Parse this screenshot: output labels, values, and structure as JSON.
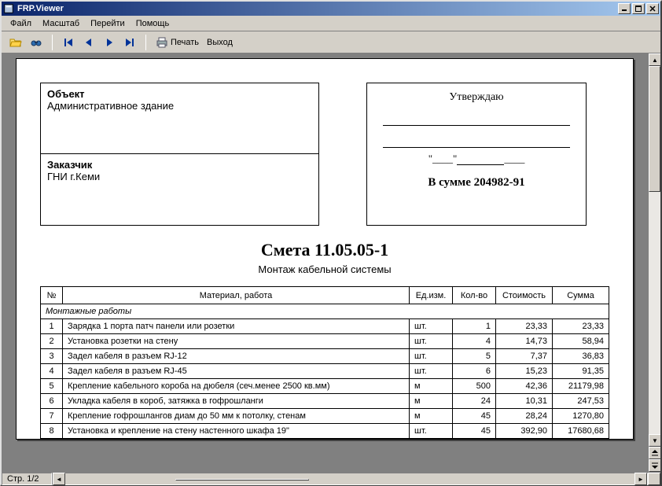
{
  "window": {
    "title": "FRP.Viewer"
  },
  "menu": {
    "file": "Файл",
    "zoom": "Масштаб",
    "goto": "Перейти",
    "help": "Помощь"
  },
  "toolbar": {
    "print": "Печать",
    "exit": "Выход"
  },
  "status": {
    "page": "Стр. 1/2"
  },
  "doc": {
    "object_label": "Объект",
    "object_value": "Административное здание",
    "customer_label": "Заказчик",
    "customer_value": "ГНИ г.Кеми",
    "approve": "Утверждаю",
    "sum_prefix": "В сумме ",
    "sum_value": "204982-91",
    "title": "Смета 11.05.05-1",
    "subtitle": "Монтаж кабельной системы",
    "headers": {
      "n": "№",
      "item": "Материал, работа",
      "unit": "Ед.изм.",
      "qty": "Кол-во",
      "cost": "Стоимость",
      "sum": "Сумма"
    },
    "section": "Монтажные работы",
    "rows": [
      {
        "n": "1",
        "item": "Зарядка 1 порта патч панели или розетки",
        "unit": "шт.",
        "qty": "1",
        "cost": "23,33",
        "sum": "23,33"
      },
      {
        "n": "2",
        "item": "Установка розетки на стену",
        "unit": "шт.",
        "qty": "4",
        "cost": "14,73",
        "sum": "58,94"
      },
      {
        "n": "3",
        "item": "Задел кабеля в разъем RJ-12",
        "unit": "шт.",
        "qty": "5",
        "cost": "7,37",
        "sum": "36,83"
      },
      {
        "n": "4",
        "item": "Задел кабеля в разъем RJ-45",
        "unit": "шт.",
        "qty": "6",
        "cost": "15,23",
        "sum": "91,35"
      },
      {
        "n": "5",
        "item": "Крепление кабельного короба на дюбеля (сеч.менее 2500 кв.мм)",
        "unit": "м",
        "qty": "500",
        "cost": "42,36",
        "sum": "21179,98"
      },
      {
        "n": "6",
        "item": "Укладка кабеля в короб, затяжка в гофрошланги",
        "unit": "м",
        "qty": "24",
        "cost": "10,31",
        "sum": "247,53"
      },
      {
        "n": "7",
        "item": "Крепление гофрошлангов диам до 50 мм к потолку, стенам",
        "unit": "м",
        "qty": "45",
        "cost": "28,24",
        "sum": "1270,80"
      },
      {
        "n": "8",
        "item": "Установка и крепление на стену настенного шкафа 19\"",
        "unit": "шт.",
        "qty": "45",
        "cost": "392,90",
        "sum": "17680,68"
      }
    ]
  }
}
